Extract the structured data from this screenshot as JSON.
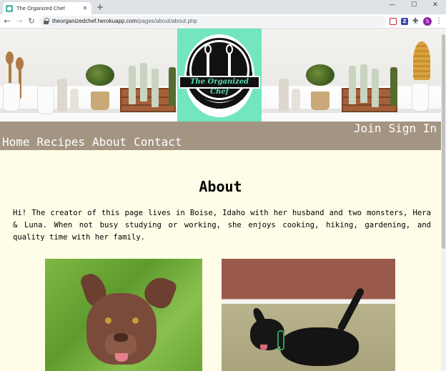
{
  "browser": {
    "tab_title": "The Organized Chef",
    "tab_close": "✕",
    "new_tab": "+",
    "window_minimize": "—",
    "window_maximize": "☐",
    "window_close": "✕",
    "url_host": "theorganizedchef.herokuapp.com",
    "url_path": "/pages/about/about.php",
    "profile_initial": "S",
    "extension_z": "Z",
    "icons": [
      "back-arrow-icon",
      "forward-arrow-icon",
      "reload-icon",
      "lock-icon",
      "star-icon",
      "extension-icon",
      "puzzle-icon",
      "more-icon"
    ]
  },
  "header": {
    "logo_text": "The Organized Chef"
  },
  "nav": {
    "right": [
      "Join",
      "Sign In"
    ],
    "left": [
      "Home",
      "Recipes",
      "About",
      "Contact"
    ]
  },
  "main": {
    "title": "About",
    "intro": "Hi! The creator of this page lives in Boise, Idaho with her husband and two monsters, Hera & Luna. When not busy studying or working, she enjoys cooking, hiking, gardening, and quality time with her family."
  },
  "colors": {
    "page_background": "#fffde8",
    "navbar": "#a49583",
    "logo_background": "#73e6c0"
  }
}
